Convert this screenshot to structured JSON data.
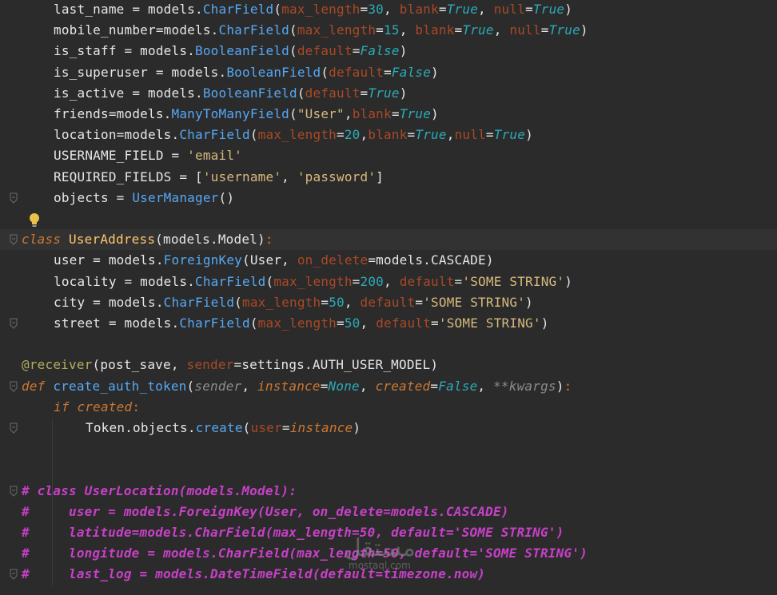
{
  "editor": {
    "language": "python",
    "lines": [
      {
        "indent": 1,
        "tokens": [
          [
            "t-default",
            "last_name = models."
          ],
          [
            "t-call",
            "CharField"
          ],
          [
            "t-default",
            "("
          ],
          [
            "t-param",
            "max_length"
          ],
          [
            "t-default",
            "="
          ],
          [
            "t-num",
            "30"
          ],
          [
            "t-default",
            ", "
          ],
          [
            "t-param",
            "blank"
          ],
          [
            "t-default",
            "="
          ],
          [
            "t-italic-blue",
            "True"
          ],
          [
            "t-default",
            ", "
          ],
          [
            "t-param",
            "null"
          ],
          [
            "t-default",
            "="
          ],
          [
            "t-italic-blue",
            "True"
          ],
          [
            "t-default",
            ")"
          ]
        ]
      },
      {
        "indent": 1,
        "tokens": [
          [
            "t-default",
            "mobile_number=models."
          ],
          [
            "t-call",
            "CharField"
          ],
          [
            "t-default",
            "("
          ],
          [
            "t-param",
            "max_length"
          ],
          [
            "t-default",
            "="
          ],
          [
            "t-num",
            "15"
          ],
          [
            "t-default",
            ", "
          ],
          [
            "t-param",
            "blank"
          ],
          [
            "t-default",
            "="
          ],
          [
            "t-italic-blue",
            "True"
          ],
          [
            "t-default",
            ", "
          ],
          [
            "t-param",
            "null"
          ],
          [
            "t-default",
            "="
          ],
          [
            "t-italic-blue",
            "True"
          ],
          [
            "t-default",
            ")"
          ]
        ]
      },
      {
        "indent": 1,
        "tokens": [
          [
            "t-default",
            "is_staff = models."
          ],
          [
            "t-call",
            "BooleanField"
          ],
          [
            "t-default",
            "("
          ],
          [
            "t-param",
            "default"
          ],
          [
            "t-default",
            "="
          ],
          [
            "t-italic-blue",
            "False"
          ],
          [
            "t-default",
            ")"
          ]
        ]
      },
      {
        "indent": 1,
        "tokens": [
          [
            "t-default",
            "is_superuser = models."
          ],
          [
            "t-call",
            "BooleanField"
          ],
          [
            "t-default",
            "("
          ],
          [
            "t-param",
            "default"
          ],
          [
            "t-default",
            "="
          ],
          [
            "t-italic-blue",
            "False"
          ],
          [
            "t-default",
            ")"
          ]
        ]
      },
      {
        "indent": 1,
        "tokens": [
          [
            "t-default",
            "is_active = models."
          ],
          [
            "t-call",
            "BooleanField"
          ],
          [
            "t-default",
            "("
          ],
          [
            "t-param",
            "default"
          ],
          [
            "t-default",
            "="
          ],
          [
            "t-italic-blue",
            "True"
          ],
          [
            "t-default",
            ")"
          ]
        ]
      },
      {
        "indent": 1,
        "tokens": [
          [
            "t-default",
            "friends=models."
          ],
          [
            "t-call",
            "ManyToManyField"
          ],
          [
            "t-default",
            "("
          ],
          [
            "t-strv",
            "\"User\""
          ],
          [
            "t-default",
            ","
          ],
          [
            "t-param",
            "blank"
          ],
          [
            "t-default",
            "="
          ],
          [
            "t-italic-blue",
            "True"
          ],
          [
            "t-default",
            ")"
          ]
        ]
      },
      {
        "indent": 1,
        "tokens": [
          [
            "t-default",
            "location=models."
          ],
          [
            "t-call",
            "CharField"
          ],
          [
            "t-default",
            "("
          ],
          [
            "t-param",
            "max_length"
          ],
          [
            "t-default",
            "="
          ],
          [
            "t-num",
            "20"
          ],
          [
            "t-default",
            ","
          ],
          [
            "t-param",
            "blank"
          ],
          [
            "t-default",
            "="
          ],
          [
            "t-italic-blue",
            "True"
          ],
          [
            "t-default",
            ","
          ],
          [
            "t-param",
            "null"
          ],
          [
            "t-default",
            "="
          ],
          [
            "t-italic-blue",
            "True"
          ],
          [
            "t-default",
            ")"
          ]
        ]
      },
      {
        "indent": 1,
        "tokens": [
          [
            "t-default",
            "USERNAME_FIELD = "
          ],
          [
            "t-strv",
            "'email'"
          ]
        ]
      },
      {
        "indent": 1,
        "tokens": [
          [
            "t-default",
            "REQUIRED_FIELDS = ["
          ],
          [
            "t-strv",
            "'username'"
          ],
          [
            "t-default",
            ", "
          ],
          [
            "t-strv",
            "'password'"
          ],
          [
            "t-default",
            "]"
          ]
        ]
      },
      {
        "indent": 1,
        "tokens": [
          [
            "t-default",
            "objects = "
          ],
          [
            "t-call",
            "UserManager"
          ],
          [
            "t-default",
            "()"
          ]
        ]
      },
      {
        "indent": 0,
        "tokens": []
      },
      {
        "indent": 0,
        "hl": true,
        "tokens": [
          [
            "t-kw-italic",
            "class "
          ],
          [
            "t-classname",
            "UserAddress"
          ],
          [
            "t-default",
            "(models.Model)"
          ],
          [
            "t-keyword",
            ":"
          ]
        ]
      },
      {
        "indent": 1,
        "tokens": [
          [
            "t-default",
            "user = models."
          ],
          [
            "t-call",
            "ForeignKey"
          ],
          [
            "t-default",
            "(User, "
          ],
          [
            "t-param",
            "on_delete"
          ],
          [
            "t-default",
            "=models.CASCADE)"
          ]
        ]
      },
      {
        "indent": 1,
        "tokens": [
          [
            "t-default",
            "locality = models."
          ],
          [
            "t-call",
            "CharField"
          ],
          [
            "t-default",
            "("
          ],
          [
            "t-param",
            "max_length"
          ],
          [
            "t-default",
            "="
          ],
          [
            "t-num",
            "200"
          ],
          [
            "t-default",
            ", "
          ],
          [
            "t-param",
            "default"
          ],
          [
            "t-default",
            "="
          ],
          [
            "t-strv",
            "'SOME STRING'"
          ],
          [
            "t-default",
            ")"
          ]
        ]
      },
      {
        "indent": 1,
        "tokens": [
          [
            "t-default",
            "city = models."
          ],
          [
            "t-call",
            "CharField"
          ],
          [
            "t-default",
            "("
          ],
          [
            "t-param",
            "max_length"
          ],
          [
            "t-default",
            "="
          ],
          [
            "t-num",
            "50"
          ],
          [
            "t-default",
            ", "
          ],
          [
            "t-param",
            "default"
          ],
          [
            "t-default",
            "="
          ],
          [
            "t-strv",
            "'SOME STRING'"
          ],
          [
            "t-default",
            ")"
          ]
        ]
      },
      {
        "indent": 1,
        "tokens": [
          [
            "t-default",
            "street = models."
          ],
          [
            "t-call",
            "CharField"
          ],
          [
            "t-default",
            "("
          ],
          [
            "t-param",
            "max_length"
          ],
          [
            "t-default",
            "="
          ],
          [
            "t-num",
            "50"
          ],
          [
            "t-default",
            ", "
          ],
          [
            "t-param",
            "default"
          ],
          [
            "t-default",
            "="
          ],
          [
            "t-strv",
            "'SOME STRING'"
          ],
          [
            "t-default",
            ")"
          ]
        ]
      },
      {
        "indent": 0,
        "tokens": []
      },
      {
        "indent": 0,
        "tokens": [
          [
            "t-deco",
            "@receiver"
          ],
          [
            "t-default",
            "(post_save, "
          ],
          [
            "t-param",
            "sender"
          ],
          [
            "t-default",
            "=settings.AUTH_USER_MODEL)"
          ]
        ]
      },
      {
        "indent": 0,
        "tokens": [
          [
            "t-kw-italic",
            "def "
          ],
          [
            "t-call",
            "create_auth_token"
          ],
          [
            "t-default",
            "("
          ],
          [
            "t-gray-italic",
            "sender"
          ],
          [
            "t-default",
            ", "
          ],
          [
            "t-arg-orange",
            "instance"
          ],
          [
            "t-default",
            "="
          ],
          [
            "t-italic-blue",
            "None"
          ],
          [
            "t-default",
            ", "
          ],
          [
            "t-arg-orange",
            "created"
          ],
          [
            "t-default",
            "="
          ],
          [
            "t-italic-blue",
            "False"
          ],
          [
            "t-default",
            ", "
          ],
          [
            "t-gray-italic",
            "**kwargs"
          ],
          [
            "t-default",
            ")"
          ],
          [
            "t-keyword",
            ":"
          ]
        ]
      },
      {
        "indent": 1,
        "tokens": [
          [
            "t-kw-italic",
            "if "
          ],
          [
            "t-arg-orange",
            "created"
          ],
          [
            "t-keyword",
            ":"
          ]
        ]
      },
      {
        "indent": 2,
        "tokens": [
          [
            "t-default",
            "Token.objects."
          ],
          [
            "t-call",
            "create"
          ],
          [
            "t-default",
            "("
          ],
          [
            "t-param",
            "user"
          ],
          [
            "t-default",
            "="
          ],
          [
            "t-arg-orange",
            "instance"
          ],
          [
            "t-default",
            ")"
          ]
        ]
      },
      {
        "indent": 0,
        "tokens": []
      },
      {
        "indent": 0,
        "tokens": []
      },
      {
        "indent": 0,
        "tokens": [
          [
            "t-comment",
            "# class UserLocation(models.Model):"
          ]
        ]
      },
      {
        "indent": 0,
        "tokens": [
          [
            "t-comment",
            "#     user = models.ForeignKey(User, on_delete=models.CASCADE)"
          ]
        ]
      },
      {
        "indent": 0,
        "tokens": [
          [
            "t-comment",
            "#     latitude=models.CharField(max_length=50, default='SOME STRING')"
          ]
        ]
      },
      {
        "indent": 0,
        "tokens": [
          [
            "t-comment",
            "#     longitude = models.CharField(max_length=50, default='SOME STRING')"
          ]
        ]
      },
      {
        "indent": 0,
        "tokens": [
          [
            "t-comment",
            "#     last_log = models.DateTimeField(default=timezone.now)"
          ]
        ]
      }
    ]
  },
  "watermark": {
    "text": "مستقل",
    "subtext": "mostaql.com"
  },
  "icons": {
    "intention": "lightbulb-icon",
    "fold": "fold-icon"
  }
}
